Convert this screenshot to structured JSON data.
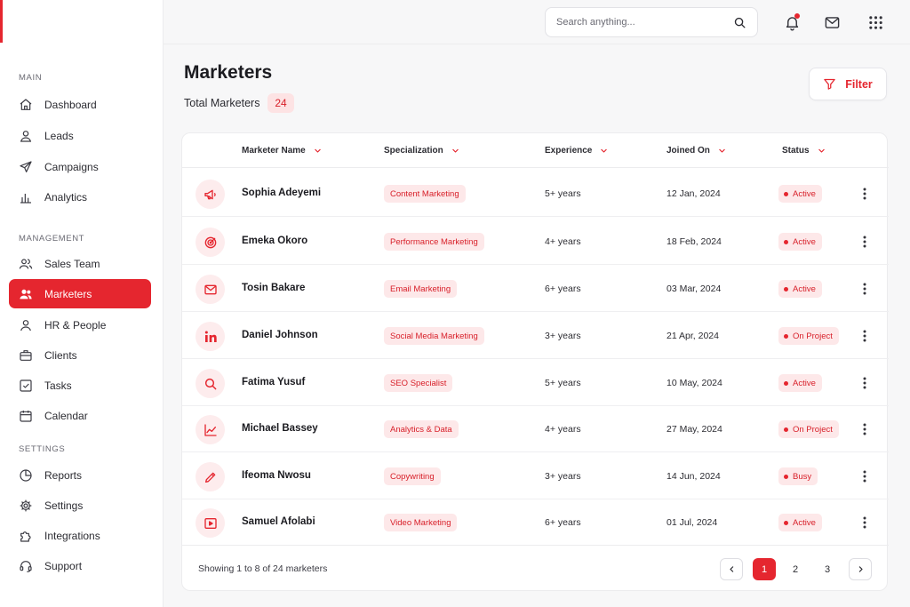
{
  "sidebar": {
    "sections": {
      "main": "MAIN",
      "management": "MANAGEMENT",
      "settings": "SETTINGS"
    },
    "items": [
      {
        "label": "Dashboard",
        "icon": "home-icon"
      },
      {
        "label": "Leads",
        "icon": "user-icon"
      },
      {
        "label": "Campaigns",
        "icon": "send-icon"
      },
      {
        "label": "Analytics",
        "icon": "bar-chart-icon"
      },
      {
        "label": "Sales Team",
        "icon": "users-icon"
      },
      {
        "label": "Marketers",
        "icon": "users-icon",
        "active": true
      },
      {
        "label": "HR & People",
        "icon": "user-icon"
      },
      {
        "label": "Clients",
        "icon": "briefcase-icon"
      },
      {
        "label": "Tasks",
        "icon": "checkbox-icon"
      },
      {
        "label": "Calendar",
        "icon": "calendar-icon"
      },
      {
        "label": "Reports",
        "icon": "pie-chart-icon"
      },
      {
        "label": "Settings",
        "icon": "gear-icon"
      },
      {
        "label": "Integrations",
        "icon": "puzzle-icon"
      },
      {
        "label": "Support",
        "icon": "headset-icon"
      }
    ]
  },
  "topbar": {
    "search_placeholder": "Search anything...",
    "notification_unread": true
  },
  "page": {
    "title": "Marketers",
    "total_label": "Total Marketers",
    "total_count": "24",
    "filter_label": "Filter"
  },
  "table": {
    "columns": [
      "Marketer Name",
      "Specialization",
      "Experience",
      "Joined On",
      "Status"
    ],
    "rows": [
      {
        "icon": "megaphone-icon",
        "name": "Sophia Adeyemi",
        "specialization": "Content Marketing",
        "experience": "5+ years",
        "joined": "12 Jan, 2024",
        "status": "Active"
      },
      {
        "icon": "target-icon",
        "name": "Emeka Okoro",
        "specialization": "Performance Marketing",
        "experience": "4+ years",
        "joined": "18 Feb, 2024",
        "status": "Active"
      },
      {
        "icon": "mail-icon",
        "name": "Tosin Bakare",
        "specialization": "Email Marketing",
        "experience": "6+ years",
        "joined": "03 Mar, 2024",
        "status": "Active"
      },
      {
        "icon": "linkedin-icon",
        "name": "Daniel Johnson",
        "specialization": "Social Media Marketing",
        "experience": "3+ years",
        "joined": "21 Apr, 2024",
        "status": "On Project"
      },
      {
        "icon": "search-icon",
        "name": "Fatima Yusuf",
        "specialization": "SEO Specialist",
        "experience": "5+ years",
        "joined": "10 May, 2024",
        "status": "Active"
      },
      {
        "icon": "trend-chart-icon",
        "name": "Michael Bassey",
        "specialization": "Analytics & Data",
        "experience": "4+ years",
        "joined": "27 May, 2024",
        "status": "On Project"
      },
      {
        "icon": "pen-icon",
        "name": "Ifeoma Nwosu",
        "specialization": "Copywriting",
        "experience": "3+ years",
        "joined": "14 Jun, 2024",
        "status": "Busy"
      },
      {
        "icon": "video-icon",
        "name": "Samuel Afolabi",
        "specialization": "Video Marketing",
        "experience": "6+ years",
        "joined": "01 Jul, 2024",
        "status": "Active"
      }
    ]
  },
  "footer": {
    "showing": "Showing 1 to 8 of 24 marketers",
    "pages": [
      "1",
      "2",
      "3"
    ],
    "current_page": "1"
  },
  "colors": {
    "accent": "#e5262f",
    "accent_soft": "#fde8e9"
  }
}
